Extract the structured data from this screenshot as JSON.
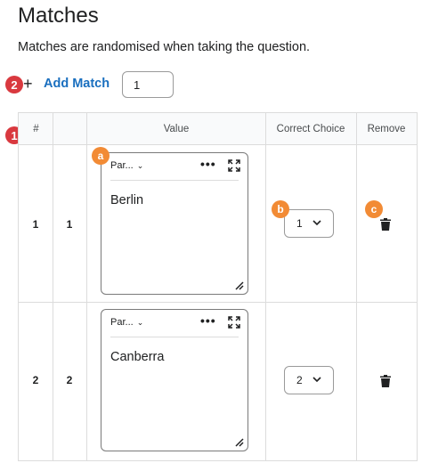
{
  "page": {
    "title": "Matches",
    "description": "Matches are randomised when taking the question."
  },
  "add_match": {
    "badge": "2",
    "plus": "+",
    "label": "Add Match",
    "count_value": "1"
  },
  "table": {
    "badge": "1",
    "headers": {
      "number": "#",
      "value": "Value",
      "correct_choice": "Correct Choice",
      "remove": "Remove"
    },
    "rows": [
      {
        "index": "1",
        "match_no": "1",
        "format_label": "Par...",
        "text": "Berlin",
        "choice": "1"
      },
      {
        "index": "2",
        "match_no": "2",
        "format_label": "Par...",
        "text": "Canberra",
        "choice": "2"
      }
    ]
  },
  "callouts": {
    "a": "a",
    "b": "b",
    "c": "c"
  },
  "icons": {
    "more": "more-options-icon",
    "expand": "expand-icon",
    "chevron": "chevron-down-icon",
    "trash": "trash-icon",
    "resize": "resize-handle-icon"
  },
  "colors": {
    "link": "#1a6fbf",
    "red_badge": "#d9393f",
    "orange_badge": "#f28b35"
  }
}
